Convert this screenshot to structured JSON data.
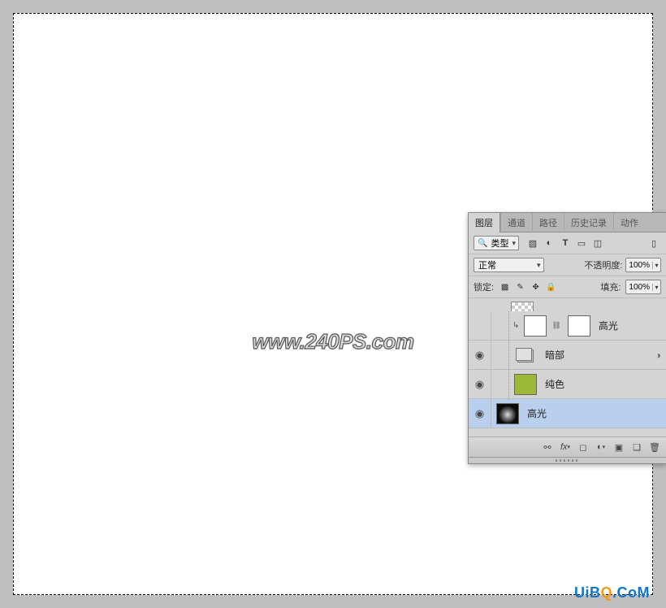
{
  "canvas": {},
  "watermark": "www.240PS.com",
  "brand": {
    "pre": "UiB",
    "o": "Q",
    "post": ".C",
    "m": "oM"
  },
  "panel": {
    "tabs": [
      "图层",
      "通道",
      "路径",
      "历史记录",
      "动作"
    ],
    "activeTab": 0,
    "filter": {
      "label": "类型"
    },
    "filterIcons": [
      "image-icon",
      "adjust-icon",
      "text-icon",
      "shape-icon",
      "smart-icon"
    ],
    "blend": {
      "mode": "正常",
      "opacityLabel": "不透明度:",
      "opacity": "100%"
    },
    "lock": {
      "label": "锁定:",
      "fillLabel": "填充:",
      "fill": "100%"
    },
    "layers": [
      {
        "vis": false,
        "eye": "",
        "indent": true,
        "clip": true,
        "thumbs": [
          "white",
          "link",
          "mask"
        ],
        "name": "高光",
        "sel": false
      },
      {
        "vis": true,
        "eye": "◉",
        "indent": true,
        "clip": false,
        "thumbs": [
          "group"
        ],
        "name": "暗部",
        "sel": false
      },
      {
        "vis": true,
        "eye": "◉",
        "indent": true,
        "clip": false,
        "thumbs": [
          "green"
        ],
        "name": "纯色",
        "sel": false
      },
      {
        "vis": true,
        "eye": "◉",
        "indent": false,
        "clip": false,
        "thumbs": [
          "dark"
        ],
        "name": "高光",
        "sel": true
      }
    ],
    "footer": [
      "link",
      "fx",
      "mask",
      "adjust",
      "group",
      "new",
      "trash"
    ]
  }
}
